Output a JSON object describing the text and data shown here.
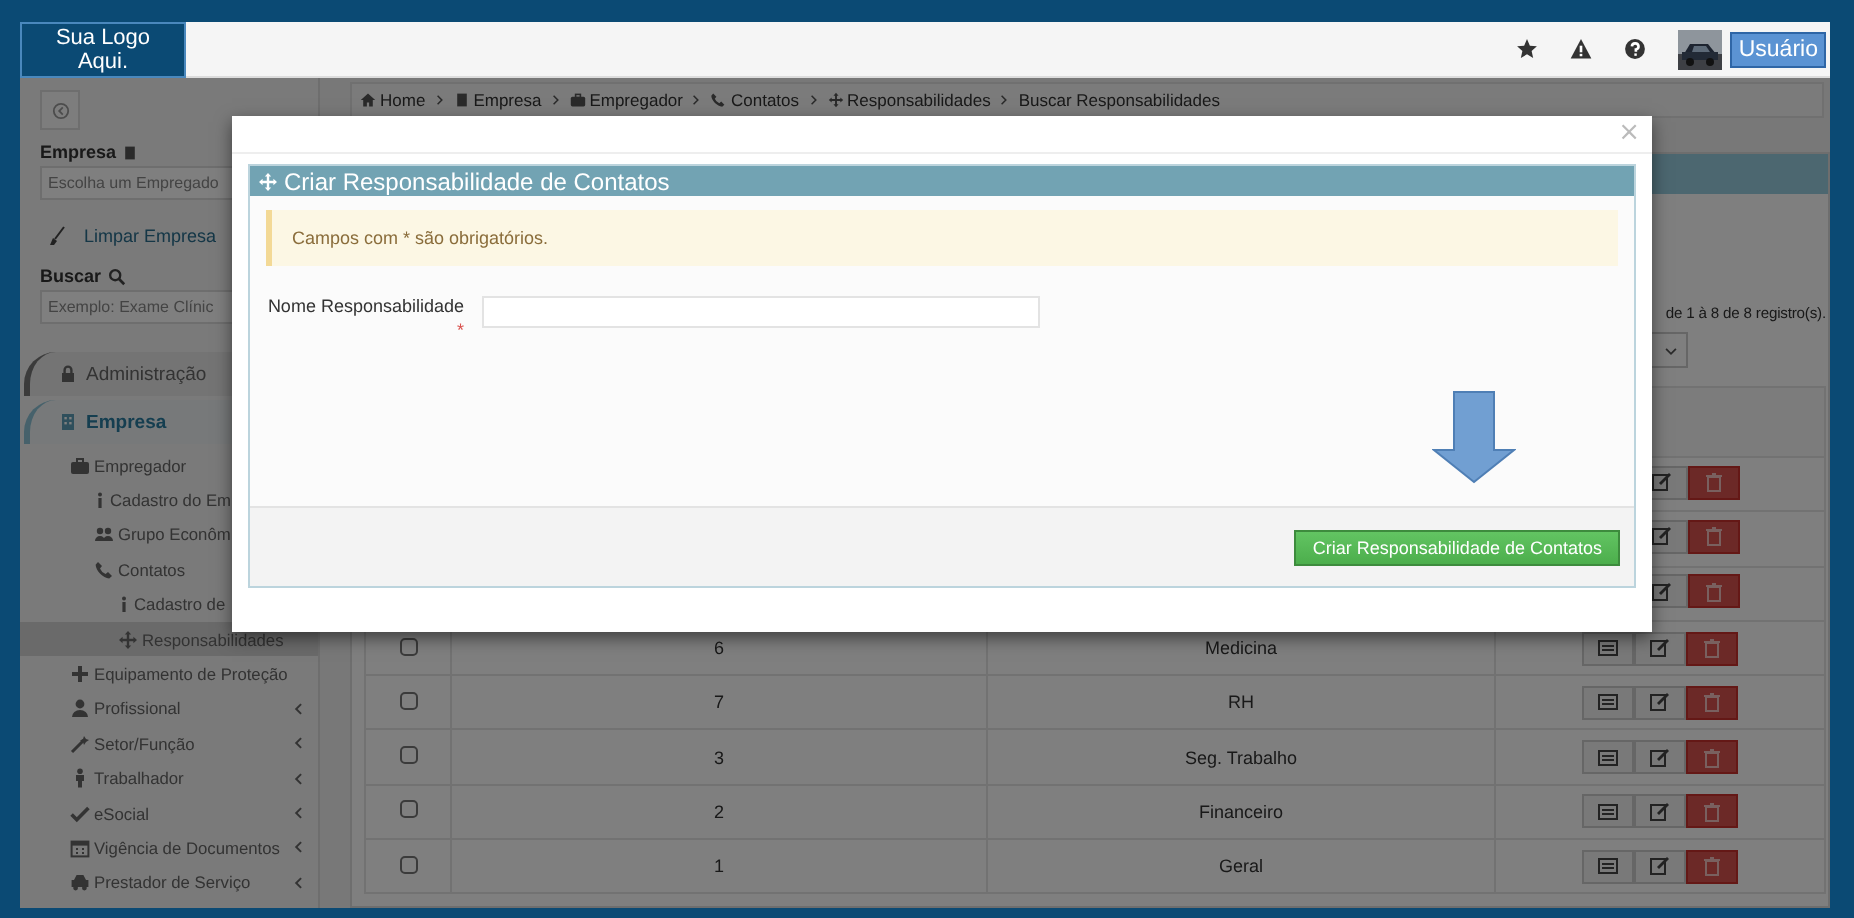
{
  "header": {
    "logo": "Sua Logo Aqui.",
    "user_button": "Usuário"
  },
  "sidebar": {
    "company_label": "Empresa",
    "company_placeholder": "Escolha um Empregado",
    "clear_link": "Limpar Empresa",
    "search_label": "Buscar",
    "search_placeholder": "Exemplo: Exame Clínic",
    "menu": [
      {
        "kind": "section",
        "label": "Administração",
        "selected": false
      },
      {
        "kind": "section",
        "label": "Empresa",
        "selected": true,
        "children": [
          {
            "kind": "item",
            "label": "Empregador",
            "selected": false,
            "children": [
              {
                "kind": "item",
                "label": "Cadastro do Em",
                "selected": false
              },
              {
                "kind": "item",
                "label": "Grupo Econôm",
                "selected": false
              },
              {
                "kind": "item",
                "label": "Contatos",
                "selected": false,
                "children": [
                  {
                    "kind": "item",
                    "label": "Cadastro de",
                    "selected": false
                  },
                  {
                    "kind": "item",
                    "label": "Responsabilidades",
                    "selected": true
                  }
                ]
              }
            ]
          },
          {
            "kind": "item",
            "label": "Equipamento de Proteção",
            "selected": false
          }
        ]
      },
      {
        "kind": "item",
        "label": "Profissional",
        "selected": false,
        "expanded": false
      },
      {
        "kind": "item",
        "label": "Setor/Função",
        "selected": false,
        "expanded": false
      },
      {
        "kind": "item",
        "label": "Trabalhador",
        "selected": false,
        "expanded": false
      },
      {
        "kind": "item",
        "label": "eSocial",
        "selected": false,
        "expanded": false
      },
      {
        "kind": "item",
        "label": "Vigência de Documentos",
        "selected": false,
        "expanded": false
      },
      {
        "kind": "item",
        "label": "Prestador de Serviço",
        "selected": false,
        "expanded": false
      }
    ]
  },
  "breadcrumb": [
    "Home",
    "Empresa",
    "Empregador",
    "Contatos",
    "Responsabilidades",
    "Buscar Responsabilidades"
  ],
  "records_info": "de 1 à 8 de 8 registro(s).",
  "table": {
    "rows": [
      {
        "kind": "covered"
      },
      {
        "kind": "covered"
      },
      {
        "kind": "covered"
      },
      {
        "kind": "row",
        "checked": false,
        "id": "6",
        "name": "Medicina"
      },
      {
        "kind": "row",
        "checked": false,
        "id": "7",
        "name": "RH"
      },
      {
        "kind": "row",
        "checked": false,
        "id": "3",
        "name": "Seg. Trabalho"
      },
      {
        "kind": "row",
        "checked": false,
        "id": "2",
        "name": "Financeiro"
      },
      {
        "kind": "row",
        "checked": false,
        "id": "1",
        "name": "Geral"
      }
    ]
  },
  "modal": {
    "close": "×",
    "title": "Criar Responsabilidade de Contatos",
    "notice": "Campos com * são obrigatórios.",
    "field_label": "Nome Responsabilidade",
    "required_mark": "*",
    "submit": "Criar Responsabilidade de Contatos"
  }
}
